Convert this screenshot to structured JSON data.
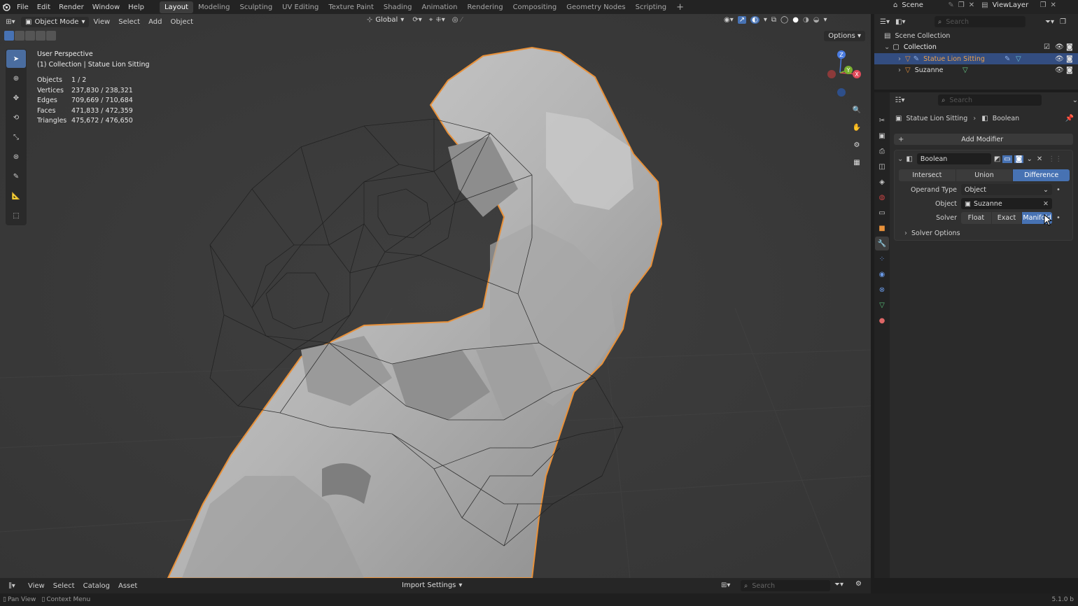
{
  "menu": [
    "File",
    "Edit",
    "Render",
    "Window",
    "Help"
  ],
  "workspaces": [
    "Layout",
    "Modeling",
    "Sculpting",
    "UV Editing",
    "Texture Paint",
    "Shading",
    "Animation",
    "Rendering",
    "Compositing",
    "Geometry Nodes",
    "Scripting"
  ],
  "active_workspace": "Layout",
  "scene": {
    "name": "Scene",
    "view_layer": "ViewLayer"
  },
  "viewport": {
    "mode": "Object Mode",
    "menus": [
      "View",
      "Select",
      "Add",
      "Object"
    ],
    "transform": "Global",
    "options_label": "Options",
    "perspective": "User Perspective",
    "collection_info": "(1) Collection | Statue Lion Sitting",
    "stats": [
      {
        "label": "Objects",
        "value": "1 / 2"
      },
      {
        "label": "Vertices",
        "value": "237,830 / 238,321"
      },
      {
        "label": "Edges",
        "value": "709,669 / 710,684"
      },
      {
        "label": "Faces",
        "value": "471,833 / 472,359"
      },
      {
        "label": "Triangles",
        "value": "475,672 / 476,650"
      }
    ]
  },
  "outliner": {
    "search_placeholder": "Search",
    "root": "Scene Collection",
    "collection": "Collection",
    "items": [
      "Statue Lion Sitting",
      "Suzanne"
    ]
  },
  "properties": {
    "search_placeholder": "Search",
    "breadcrumb_object": "Statue Lion Sitting",
    "breadcrumb_modifier": "Boolean",
    "add_modifier": "Add Modifier",
    "modifier_name": "Boolean",
    "operations": [
      "Intersect",
      "Union",
      "Difference"
    ],
    "active_operation": "Difference",
    "operand_type_label": "Operand Type",
    "operand_type_value": "Object",
    "object_label": "Object",
    "object_value": "Suzanne",
    "solver_label": "Solver",
    "solvers": [
      "Float",
      "Exact",
      "Manifold"
    ],
    "active_solver": "Manifold",
    "solver_options": "Solver Options"
  },
  "bottombar": {
    "menus": [
      "View",
      "Select",
      "Catalog",
      "Asset"
    ],
    "import_settings": "Import Settings",
    "search_placeholder": "Search"
  },
  "statusbar": {
    "pan_view": "Pan View",
    "context_menu": "Context Menu",
    "version": "5.1.0 b"
  },
  "colors": {
    "accent": "#4772b3",
    "selection_outline": "#e8913a",
    "viewport_bg": "#3a3a3a"
  }
}
